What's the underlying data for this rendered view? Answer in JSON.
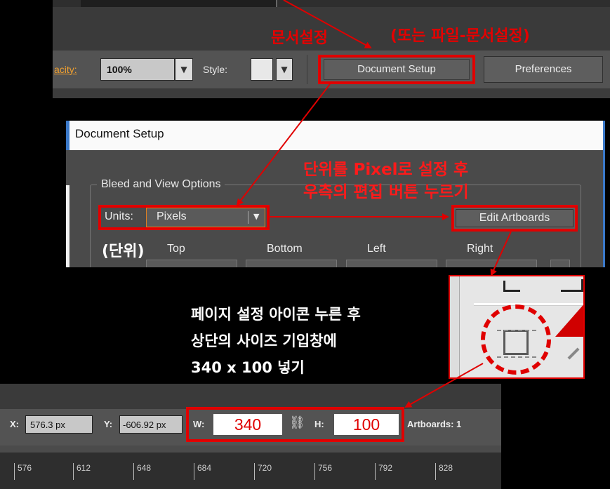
{
  "toolbar": {
    "opacity_label": "acity:",
    "opacity_value": "100%",
    "style_label": "Style:",
    "document_setup_label": "Document Setup",
    "preferences_label": "Preferences",
    "caret": "▼"
  },
  "dialog": {
    "title": "Document Setup",
    "group_label": "Bleed and View Options",
    "units_label": "Units:",
    "units_value": "Pixels",
    "edit_artboards_label": "Edit Artboards",
    "columns": [
      "Top",
      "Bottom",
      "Left",
      "Right"
    ]
  },
  "control_bar": {
    "x_label": "X:",
    "x_value": "576.3 px",
    "y_label": "Y:",
    "y_value": "-606.92 px",
    "w_label": "W:",
    "w_value": "340",
    "h_label": "H:",
    "h_value": "100",
    "artboards_label": "Artboards: 1",
    "link_icon": "⛓"
  },
  "ruler": [
    "576",
    "612",
    "648",
    "684",
    "720",
    "756",
    "792",
    "828"
  ],
  "annotations": {
    "doc_setup": "문서설정",
    "file_doc_setup": "(또는 파일-문서설정)",
    "units_line1": "단위를 Pixel로 설정 후",
    "units_line2": "우측의 편집 버튼 누르기",
    "units_note": "(단위)",
    "instructions": [
      "페이지 설정 아이콘 누른 후",
      "상단의 사이즈 기입창에",
      "340 x 100 넣기"
    ]
  },
  "colors": {
    "annotation_red": "#e60000",
    "panel_gray": "#535353",
    "dialog_accent": "#3a78c8",
    "opacity_label_orange": "#f0a030"
  }
}
